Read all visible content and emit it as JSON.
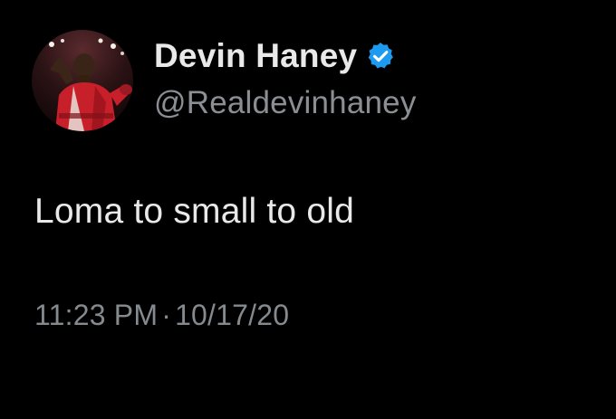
{
  "tweet": {
    "author": {
      "display_name": "Devin Haney",
      "handle": "@Realdevinhaney",
      "verified_icon": "verified-badge-icon",
      "avatar": "profile-photo"
    },
    "text": "Loma to small to old",
    "time": "11:23 PM",
    "separator": "·",
    "date": "10/17/20"
  },
  "colors": {
    "background": "#000000",
    "primary_text": "#e9e9e9",
    "secondary_text": "#8b8f94",
    "verified_blue": "#1d9bf0"
  }
}
